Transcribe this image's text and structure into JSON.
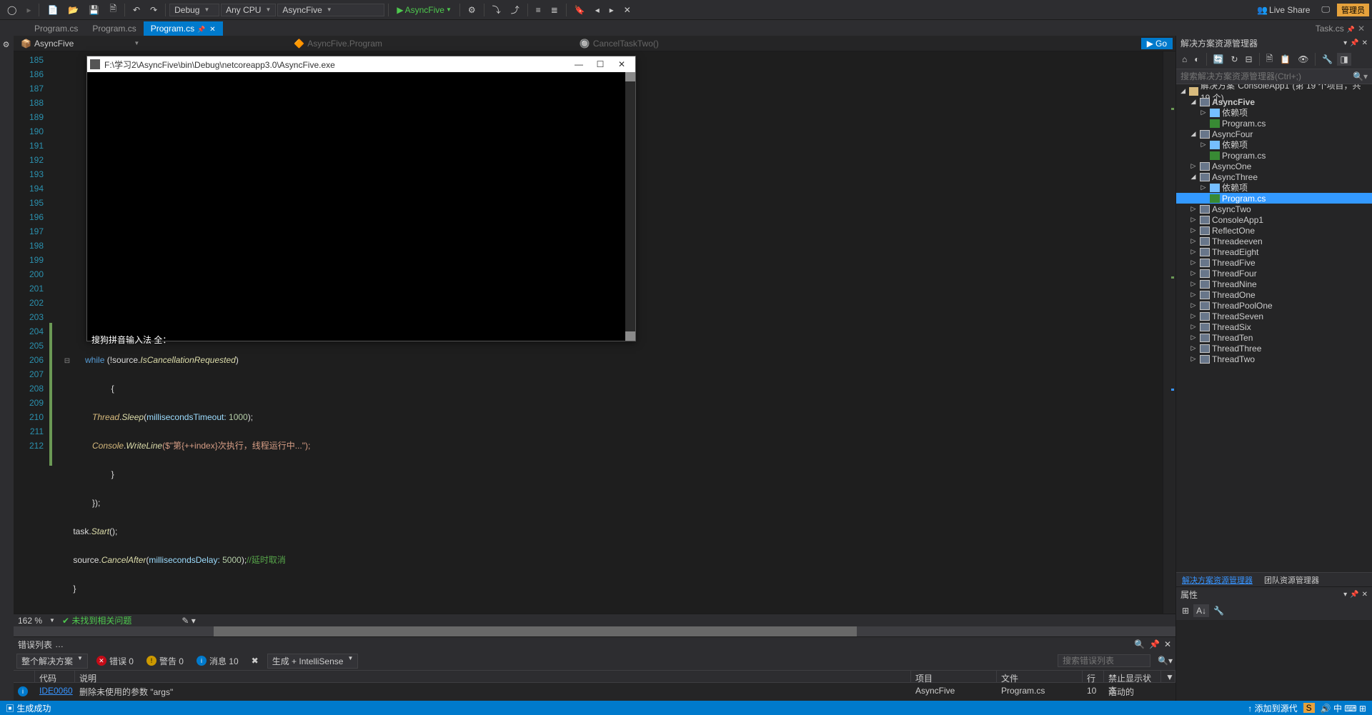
{
  "toolbar": {
    "debug": "Debug",
    "anycpu": "Any CPU",
    "target": "AsyncFive",
    "startup": "AsyncFive",
    "liveshare": "Live Share",
    "admin": "管理员"
  },
  "tabs": [
    {
      "label": "Program.cs",
      "active": false,
      "pinned": false
    },
    {
      "label": "Program.cs",
      "active": false,
      "pinned": false
    },
    {
      "label": "Program.cs",
      "active": true,
      "pinned": true
    }
  ],
  "rtab": {
    "label": "Task.cs"
  },
  "nav": {
    "scope": "AsyncFive",
    "cls": "AsyncFive.Program",
    "method": "CancelTaskTwo()",
    "go": "Go"
  },
  "lines": [
    185,
    186,
    187,
    188,
    189,
    190,
    191,
    192,
    193,
    194,
    195,
    196,
    197,
    198,
    199,
    200,
    201,
    202,
    203,
    204,
    205,
    206,
    207,
    208,
    209,
    210,
    211,
    212
  ],
  "code": {
    "l204": {
      "pre": "            ",
      "kw": "while",
      "txt1": " (!source.",
      "m": "IsCancellationRequested",
      "txt2": ")"
    },
    "l205": "            {",
    "l206": {
      "pad": "                ",
      "t1": "Thread",
      "dot1": ".",
      "m1": "Sleep",
      "op": "(",
      "p1": "millisecondsTimeout:",
      "sp": " ",
      "n1": "1000",
      "cl": ");"
    },
    "l207": {
      "pad": "                ",
      "t1": "Console",
      "dot1": ".",
      "m1": "WriteLine",
      "s": "($\"第{++index}次执行，线程运行中...\");"
    },
    "l208": "            }",
    "l209": "        });",
    "l210": {
      "pad": "        ",
      "v": "task.",
      "m": "Start",
      "cl": "();"
    },
    "l211": {
      "pad": "        ",
      "v": "source.",
      "m": "CancelAfter",
      "op": "(",
      "p": "millisecondsDelay:",
      "sp": " ",
      "n": "5000",
      "cl": ");",
      "c": "//延时取消"
    },
    "l212": "    }"
  },
  "edstat": {
    "zoom": "162 %",
    "issues": "未找到相关问题"
  },
  "errlist": {
    "title": "错误列表",
    "scope": "整个解决方案",
    "err": "错误 0",
    "warn": "警告 0",
    "msg": "消息 10",
    "build": "生成 + IntelliSense",
    "search_ph": "搜索错误列表",
    "cols": {
      "code": "代码",
      "desc": "说明",
      "proj": "项目",
      "file": "文件",
      "line": "行",
      "state": "禁止显示状态"
    },
    "row": {
      "code": "IDE0060",
      "desc": "删除未使用的参数 \"args\"",
      "proj": "AsyncFive",
      "file": "Program.cs",
      "line": "10",
      "state": "活动的"
    }
  },
  "sln": {
    "title": "解决方案资源管理器",
    "search_ph": "搜索解决方案资源管理器(Ctrl+;)",
    "root": "解决方案\"ConsoleApp1\"(第 19 个项目，共 19 个)",
    "projects": [
      {
        "name": "AsyncFive",
        "exp": true,
        "bold": true,
        "children": [
          {
            "name": "依赖项",
            "type": "dep"
          },
          {
            "name": "Program.cs",
            "type": "cs"
          }
        ]
      },
      {
        "name": "AsyncFour",
        "exp": true,
        "children": [
          {
            "name": "依赖项",
            "type": "dep"
          },
          {
            "name": "Program.cs",
            "type": "cs"
          }
        ]
      },
      {
        "name": "AsyncOne",
        "exp": false
      },
      {
        "name": "AsyncThree",
        "exp": true,
        "children": [
          {
            "name": "依赖项",
            "type": "dep"
          },
          {
            "name": "Program.cs",
            "type": "cs",
            "sel": true
          }
        ]
      },
      {
        "name": "AsyncTwo",
        "exp": false
      },
      {
        "name": "ConsoleApp1",
        "exp": false
      },
      {
        "name": "ReflectOne",
        "exp": false
      },
      {
        "name": "Threadeeven",
        "exp": false
      },
      {
        "name": "ThreadEight",
        "exp": false
      },
      {
        "name": "ThreadFive",
        "exp": false
      },
      {
        "name": "ThreadFour",
        "exp": false
      },
      {
        "name": "ThreadNine",
        "exp": false
      },
      {
        "name": "ThreadOne",
        "exp": false
      },
      {
        "name": "ThreadPoolOne",
        "exp": false
      },
      {
        "name": "ThreadSeven",
        "exp": false
      },
      {
        "name": "ThreadSix",
        "exp": false
      },
      {
        "name": "ThreadTen",
        "exp": false
      },
      {
        "name": "ThreadThree",
        "exp": false
      },
      {
        "name": "ThreadTwo",
        "exp": false
      }
    ],
    "bottom_tabs": {
      "a": "解决方案资源管理器",
      "b": "团队资源管理器"
    }
  },
  "prop": {
    "title": "属性"
  },
  "status": {
    "build": "生成成功",
    "src": "添加到源代"
  },
  "console": {
    "path": "F:\\学习2\\AsyncFive\\bin\\Debug\\netcoreapp3.0\\AsyncFive.exe"
  },
  "ime": "搜狗拼音输入法 全："
}
